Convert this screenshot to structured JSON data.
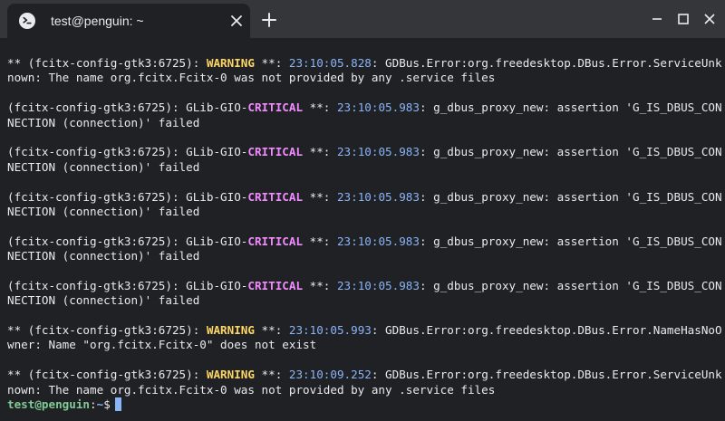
{
  "tab": {
    "title": "test@penguin: ~",
    "icon": "terminal-icon"
  },
  "window_controls": [
    "minimize-icon",
    "maximize-icon",
    "close-icon"
  ],
  "colors": {
    "warning": "#fdd663",
    "critical": "#f28bff",
    "timestamp": "#8ab4f8",
    "prompt_user": "#81c995",
    "prompt_path": "#8ab4f8",
    "text": "#e8eaed"
  },
  "terminal": {
    "lines": [
      [
        {
          "t": "** (fcitx-config-gtk3:6725): "
        },
        {
          "t": "WARNING",
          "c": "warn"
        },
        {
          "t": " **: "
        },
        {
          "t": "23:10:05.828",
          "c": "ts"
        },
        {
          "t": ": GDBus.Error:org.freedesktop.DBus.Error.ServiceUnk"
        }
      ],
      [
        {
          "t": "nown: The name org.fcitx.Fcitx-0 was not provided by any .service files"
        }
      ],
      [],
      [
        {
          "t": "(fcitx-config-gtk3:6725): GLib-GIO-"
        },
        {
          "t": "CRITICAL",
          "c": "crit"
        },
        {
          "t": " **: "
        },
        {
          "t": "23:10:05.983",
          "c": "ts"
        },
        {
          "t": ": g_dbus_proxy_new: assertion 'G_IS_DBUS_CON"
        }
      ],
      [
        {
          "t": "NECTION (connection)' failed"
        }
      ],
      [],
      [
        {
          "t": "(fcitx-config-gtk3:6725): GLib-GIO-"
        },
        {
          "t": "CRITICAL",
          "c": "crit"
        },
        {
          "t": " **: "
        },
        {
          "t": "23:10:05.983",
          "c": "ts"
        },
        {
          "t": ": g_dbus_proxy_new: assertion 'G_IS_DBUS_CON"
        }
      ],
      [
        {
          "t": "NECTION (connection)' failed"
        }
      ],
      [],
      [
        {
          "t": "(fcitx-config-gtk3:6725): GLib-GIO-"
        },
        {
          "t": "CRITICAL",
          "c": "crit"
        },
        {
          "t": " **: "
        },
        {
          "t": "23:10:05.983",
          "c": "ts"
        },
        {
          "t": ": g_dbus_proxy_new: assertion 'G_IS_DBUS_CON"
        }
      ],
      [
        {
          "t": "NECTION (connection)' failed"
        }
      ],
      [],
      [
        {
          "t": "(fcitx-config-gtk3:6725): GLib-GIO-"
        },
        {
          "t": "CRITICAL",
          "c": "crit"
        },
        {
          "t": " **: "
        },
        {
          "t": "23:10:05.983",
          "c": "ts"
        },
        {
          "t": ": g_dbus_proxy_new: assertion 'G_IS_DBUS_CON"
        }
      ],
      [
        {
          "t": "NECTION (connection)' failed"
        }
      ],
      [],
      [
        {
          "t": "(fcitx-config-gtk3:6725): GLib-GIO-"
        },
        {
          "t": "CRITICAL",
          "c": "crit"
        },
        {
          "t": " **: "
        },
        {
          "t": "23:10:05.983",
          "c": "ts"
        },
        {
          "t": ": g_dbus_proxy_new: assertion 'G_IS_DBUS_CON"
        }
      ],
      [
        {
          "t": "NECTION (connection)' failed"
        }
      ],
      [],
      [
        {
          "t": "** (fcitx-config-gtk3:6725): "
        },
        {
          "t": "WARNING",
          "c": "warn"
        },
        {
          "t": " **: "
        },
        {
          "t": "23:10:05.993",
          "c": "ts"
        },
        {
          "t": ": GDBus.Error:org.freedesktop.DBus.Error.NameHasNoO"
        }
      ],
      [
        {
          "t": "wner: Name \"org.fcitx.Fcitx-0\" does not exist"
        }
      ],
      [],
      [
        {
          "t": "** (fcitx-config-gtk3:6725): "
        },
        {
          "t": "WARNING",
          "c": "warn"
        },
        {
          "t": " **: "
        },
        {
          "t": "23:10:09.252",
          "c": "ts"
        },
        {
          "t": ": GDBus.Error:org.freedesktop.DBus.Error.ServiceUnk"
        }
      ],
      [
        {
          "t": "nown: The name org.fcitx.Fcitx-0 was not provided by any .service files"
        }
      ]
    ],
    "prompt": {
      "user_host": "test@penguin",
      "separator": ":",
      "path": "~",
      "symbol": "$"
    }
  }
}
